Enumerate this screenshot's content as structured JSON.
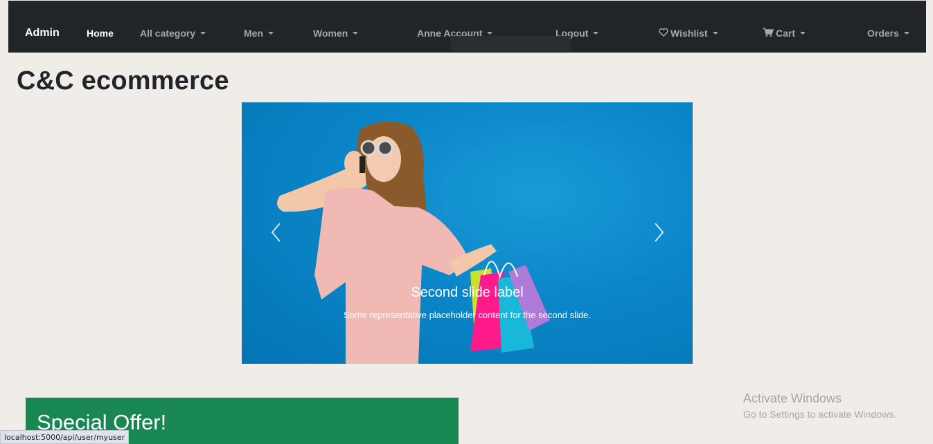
{
  "navbar": {
    "brand": "Admin",
    "items": [
      {
        "label": "Home",
        "dropdown": false
      },
      {
        "label": "All category",
        "dropdown": true
      },
      {
        "label": "Men",
        "dropdown": true
      },
      {
        "label": "Women",
        "dropdown": true
      },
      {
        "label": "Anne Account",
        "dropdown": true
      },
      {
        "label": "Logout",
        "dropdown": true
      },
      {
        "label": "Wishlist",
        "dropdown": true,
        "icon": "heart-icon"
      },
      {
        "label": "Cart",
        "dropdown": true,
        "icon": "cart-icon"
      },
      {
        "label": "Orders",
        "dropdown": true
      }
    ]
  },
  "page": {
    "title": "C&C ecommerce"
  },
  "carousel": {
    "caption_title": "Second slide label",
    "caption_text": "Some representative placeholder content for the second slide.",
    "prev_icon": "chevron-left-icon",
    "next_icon": "chevron-right-icon"
  },
  "offer": {
    "title": "Special Offer!"
  },
  "watermark": {
    "line1": "Activate Windows",
    "line2": "Go to Settings to activate Windows."
  },
  "status_bar": {
    "url": "localhost:5000/api/user/myuser"
  },
  "colors": {
    "navbar_bg": "#212529",
    "page_bg": "#f0ede9",
    "offer_bg": "#198754",
    "carousel_bg": "#0a86c8"
  }
}
